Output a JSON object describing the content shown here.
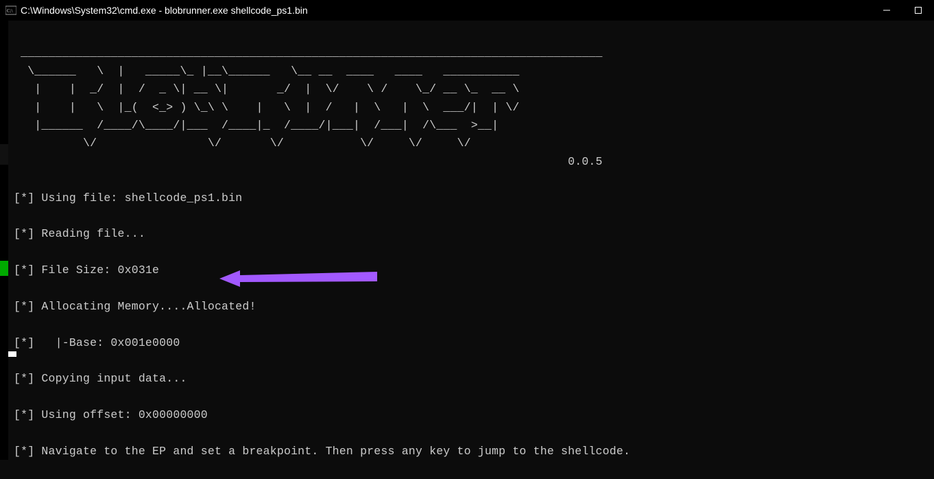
{
  "window": {
    "title": "C:\\Windows\\System32\\cmd.exe - blobrunner.exe  shellcode_ps1.bin"
  },
  "ascii_art": " ____________________________________________________________________________________\n  \\______   \\  |   _____\\_ |__\\______   \\__ __  ____   ____   ___________  \n   |    |  _/  |  /  _ \\| __ \\|       _/  |  \\/    \\ /    \\_/ __ \\_  __ \\ \n   |    |   \\  |_(  <_> ) \\_\\ \\    |   \\  |  /   |  \\   |  \\  ___/|  | \\/ \n   |______  /____/\\____/|___  /____|_  /____/|___|  /___|  /\\___  >__|    \n          \\/                \\/       \\/           \\/     \\/     \\/        \n                                                                                0.0.5   \n",
  "lines": {
    "l0": "[*] Using file: shellcode_ps1.bin",
    "l1": "[*] Reading file...",
    "l2": "[*] File Size: 0x031e",
    "l3": "[*] Allocating Memory....Allocated!",
    "l4": "[*]   |-Base: 0x001e0000",
    "l5": "[*] Copying input data...",
    "l6": "[*] Using offset: 0x00000000",
    "l7": "[*] Navigate to the EP and set a breakpoint. Then press any key to jump to the shellcode."
  },
  "version": "0.0.5",
  "annotation": {
    "color": "#a259ff"
  }
}
